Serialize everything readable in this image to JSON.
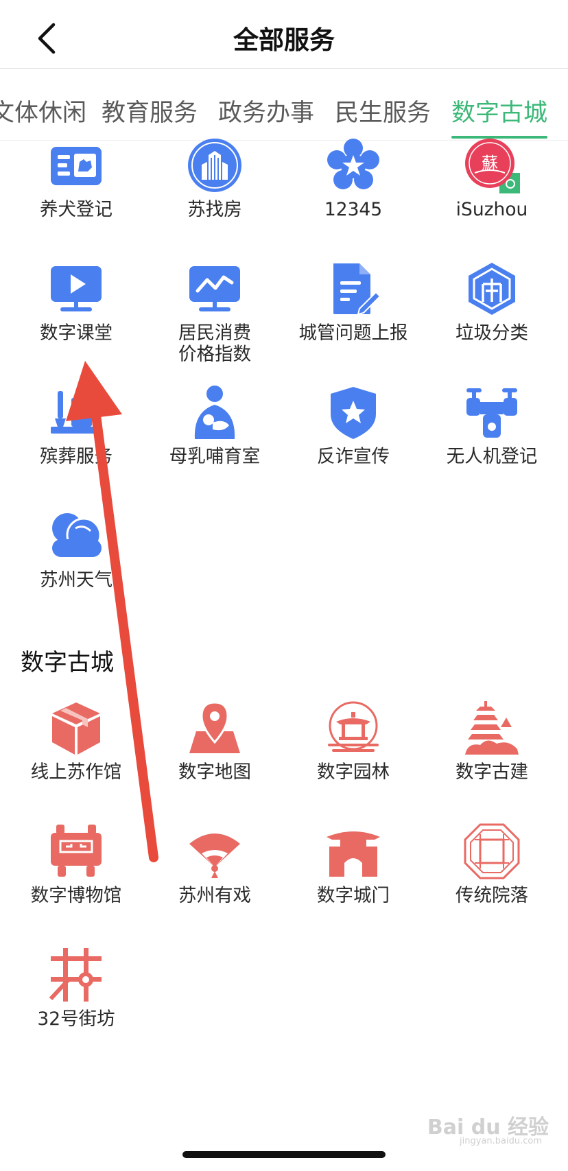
{
  "header": {
    "title": "全部服务"
  },
  "tabs": [
    {
      "label": "文体休闲",
      "active": false
    },
    {
      "label": "教育服务",
      "active": false
    },
    {
      "label": "政务办事",
      "active": false
    },
    {
      "label": "民生服务",
      "active": false
    },
    {
      "label": "数字古城",
      "active": true
    }
  ],
  "services": [
    {
      "label": "养犬登记",
      "icon": "dog-registration-icon"
    },
    {
      "label": "苏找房",
      "icon": "buildings-icon"
    },
    {
      "label": "12345",
      "icon": "star-flower-icon"
    },
    {
      "label": "iSuzhou",
      "icon": "isuzhou-logo-icon"
    },
    {
      "label": "数字课堂",
      "icon": "monitor-play-icon"
    },
    {
      "label": "居民消费\n价格指数",
      "icon": "chart-monitor-icon"
    },
    {
      "label": "城管问题上报",
      "icon": "document-edit-icon"
    },
    {
      "label": "垃圾分类",
      "icon": "recycle-hexagon-icon"
    },
    {
      "label": "殡葬服务",
      "icon": "memorial-icon"
    },
    {
      "label": "母乳哺育室",
      "icon": "mother-baby-icon"
    },
    {
      "label": "反诈宣传",
      "icon": "shield-star-icon"
    },
    {
      "label": "无人机登记",
      "icon": "drone-icon"
    },
    {
      "label": "苏州天气",
      "icon": "cloud-icon"
    }
  ],
  "section": {
    "title": "数字古城"
  },
  "ancient_city": [
    {
      "label": "线上苏作馆",
      "icon": "cube-box-icon"
    },
    {
      "label": "数字地图",
      "icon": "map-pin-icon"
    },
    {
      "label": "数字园林",
      "icon": "pavilion-icon"
    },
    {
      "label": "数字古建",
      "icon": "pagoda-icon"
    },
    {
      "label": "数字博物馆",
      "icon": "bronze-vessel-icon"
    },
    {
      "label": "苏州有戏",
      "icon": "fan-icon"
    },
    {
      "label": "数字城门",
      "icon": "city-gate-icon"
    },
    {
      "label": "传统院落",
      "icon": "lattice-window-icon"
    },
    {
      "label": "32号街坊",
      "icon": "street-block-icon"
    }
  ],
  "watermark": {
    "text": "Bai du 经验",
    "sub": "jingyan.baidu.com"
  },
  "colors": {
    "accent_green": "#3cb878",
    "service_blue": "#4a7ff0",
    "heritage_red": "#e86a63",
    "arrow_red": "#e84a3c"
  }
}
